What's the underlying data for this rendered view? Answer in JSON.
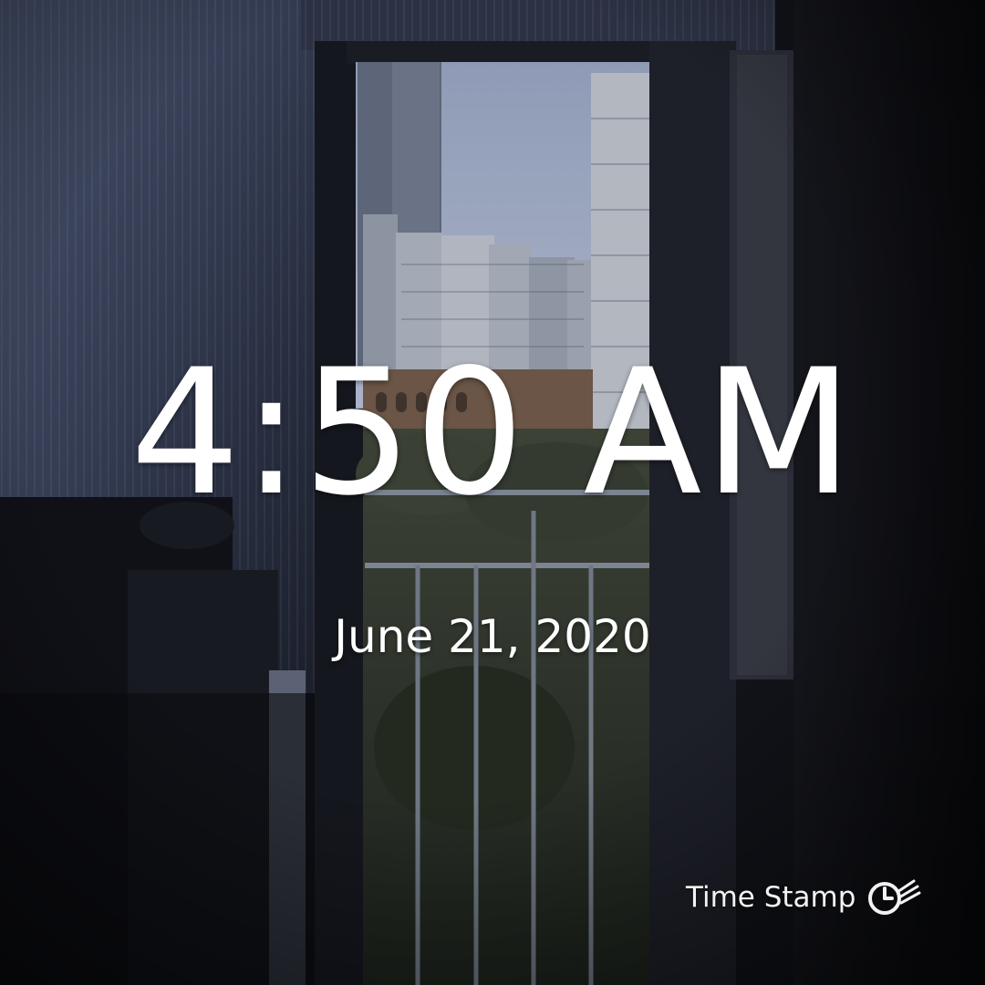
{
  "overlay": {
    "time": "4:50 AM",
    "date": "June 21, 2020"
  },
  "watermark": {
    "label": "Time Stamp",
    "icon": "clock-stamp-icon"
  },
  "colors": {
    "overlay_text": "#ffffff",
    "sky": "#9aa6bf",
    "interior_shadow": "#0c0d12"
  }
}
